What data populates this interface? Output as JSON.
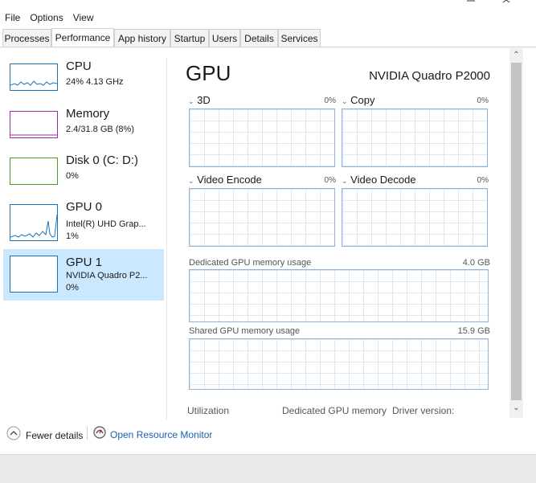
{
  "menu": [
    "File",
    "Options",
    "View"
  ],
  "tabs": [
    "Processes",
    "Performance",
    "App history",
    "Startup",
    "Users",
    "Details",
    "Services"
  ],
  "active_tab": "Performance",
  "sidebar": [
    {
      "name": "CPU",
      "line1": "24% 4.13 GHz",
      "line2": "",
      "color": "#1a73b8"
    },
    {
      "name": "Memory",
      "line1": "2.4/31.8 GB (8%)",
      "line2": "",
      "color": "#9b2c9b"
    },
    {
      "name": "Disk 0 (C: D:)",
      "line1": "0%",
      "line2": "",
      "color": "#4a9a1d"
    },
    {
      "name": "GPU 0",
      "line1": "Intel(R) UHD Grap...",
      "line2": "1%",
      "color": "#1a73b8"
    },
    {
      "name": "GPU 1",
      "line1": "NVIDIA Quadro P2...",
      "line2": "0%",
      "color": "#1a73b8",
      "selected": true
    }
  ],
  "main": {
    "title": "GPU",
    "model": "NVIDIA Quadro P2000",
    "engines": [
      {
        "label": "3D",
        "pct": "0%"
      },
      {
        "label": "Copy",
        "pct": "0%"
      },
      {
        "label": "Video Encode",
        "pct": "0%"
      },
      {
        "label": "Video Decode",
        "pct": "0%"
      }
    ],
    "dedicated": {
      "label": "Dedicated GPU memory usage",
      "value": "4.0 GB"
    },
    "shared": {
      "label": "Shared GPU memory usage",
      "value": "15.9 GB"
    },
    "stats": [
      "Utilization",
      "Dedicated GPU memory",
      "Driver version:"
    ]
  },
  "footer": {
    "fewer_details": "Fewer details",
    "resource_monitor": "Open Resource Monitor"
  },
  "colors": {
    "accent": "#1a73b8",
    "selected_bg": "#cce8ff",
    "graph_border": "#8fb2d6"
  }
}
